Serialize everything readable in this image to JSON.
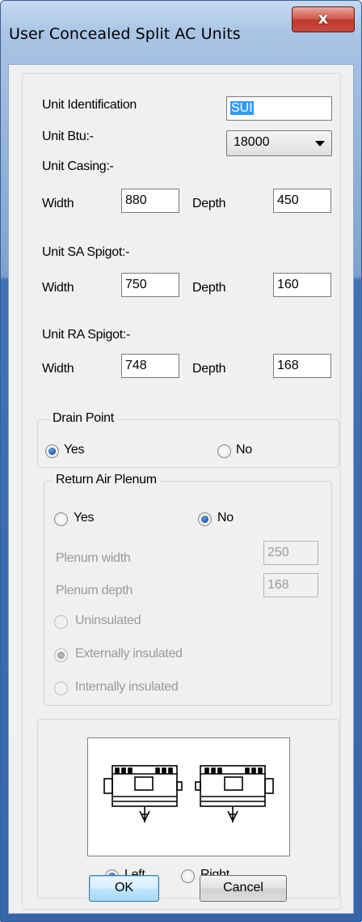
{
  "window": {
    "title": "User Concealed Split AC Units",
    "close_label": "x"
  },
  "unit_identification": {
    "label": "Unit Identification",
    "value": "SUI"
  },
  "unit_btu": {
    "label": "Unit Btu:-",
    "selected": "18000"
  },
  "unit_casing": {
    "heading": "Unit Casing:-",
    "width_label": "Width",
    "width": "880",
    "depth_label": "Depth",
    "depth": "450"
  },
  "sa_spigot": {
    "heading": "Unit SA Spigot:-",
    "width_label": "Width",
    "width": "750",
    "depth_label": "Depth",
    "depth": "160"
  },
  "ra_spigot": {
    "heading": "Unit RA Spigot:-",
    "width_label": "Width",
    "width": "748",
    "depth_label": "Depth",
    "depth": "168"
  },
  "drain_point": {
    "title": "Drain Point",
    "yes_label": "Yes",
    "no_label": "No",
    "selected": "Yes"
  },
  "return_air_plenum": {
    "title": "Return Air Plenum",
    "yes_label": "Yes",
    "no_label": "No",
    "selected": "No",
    "plenum_width_label": "Plenum width",
    "plenum_width": "250",
    "plenum_depth_label": "Plenum depth",
    "plenum_depth": "168",
    "insulation_options": [
      "Uninsulated",
      "Externally insulated",
      "Internally insulated"
    ],
    "insulation_selected": "Externally insulated"
  },
  "orientation": {
    "left_label": "Left",
    "right_label": "Right",
    "selected": "Left"
  },
  "buttons": {
    "ok": "OK",
    "cancel": "Cancel"
  },
  "colors": {
    "title_gradient_top": "#c5d9f1",
    "frame_blue": "#3566ad",
    "close_red": "#c84a3a",
    "radio_blue": "#1e5aa8",
    "selection_blue": "#3399ff"
  }
}
